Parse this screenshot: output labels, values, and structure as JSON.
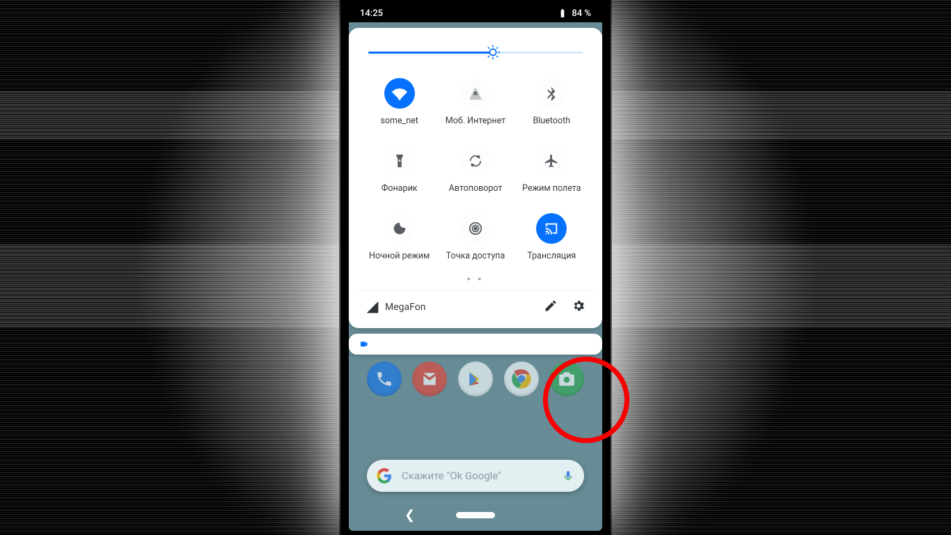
{
  "statusbar": {
    "time": "14:25",
    "battery": "84 %"
  },
  "brightness": {
    "percent": 58
  },
  "tiles": [
    {
      "key": "wifi",
      "label": "some_net",
      "active": true
    },
    {
      "key": "data",
      "label": "Моб. Интернет",
      "active": false
    },
    {
      "key": "bluetooth",
      "label": "Bluetooth",
      "active": false
    },
    {
      "key": "flash",
      "label": "Фонарик",
      "active": false
    },
    {
      "key": "rotate",
      "label": "Автоповорот",
      "active": false
    },
    {
      "key": "airplane",
      "label": "Режим полета",
      "active": false
    },
    {
      "key": "night",
      "label": "Ночной режим",
      "active": false
    },
    {
      "key": "hotspot",
      "label": "Точка доступа",
      "active": false
    },
    {
      "key": "cast",
      "label": "Трансляция",
      "active": true
    }
  ],
  "pager": {
    "current": 1,
    "total": 2
  },
  "footer": {
    "carrier": "MegaFon"
  },
  "search": {
    "hint": "Скажите \"Оk Google\""
  }
}
